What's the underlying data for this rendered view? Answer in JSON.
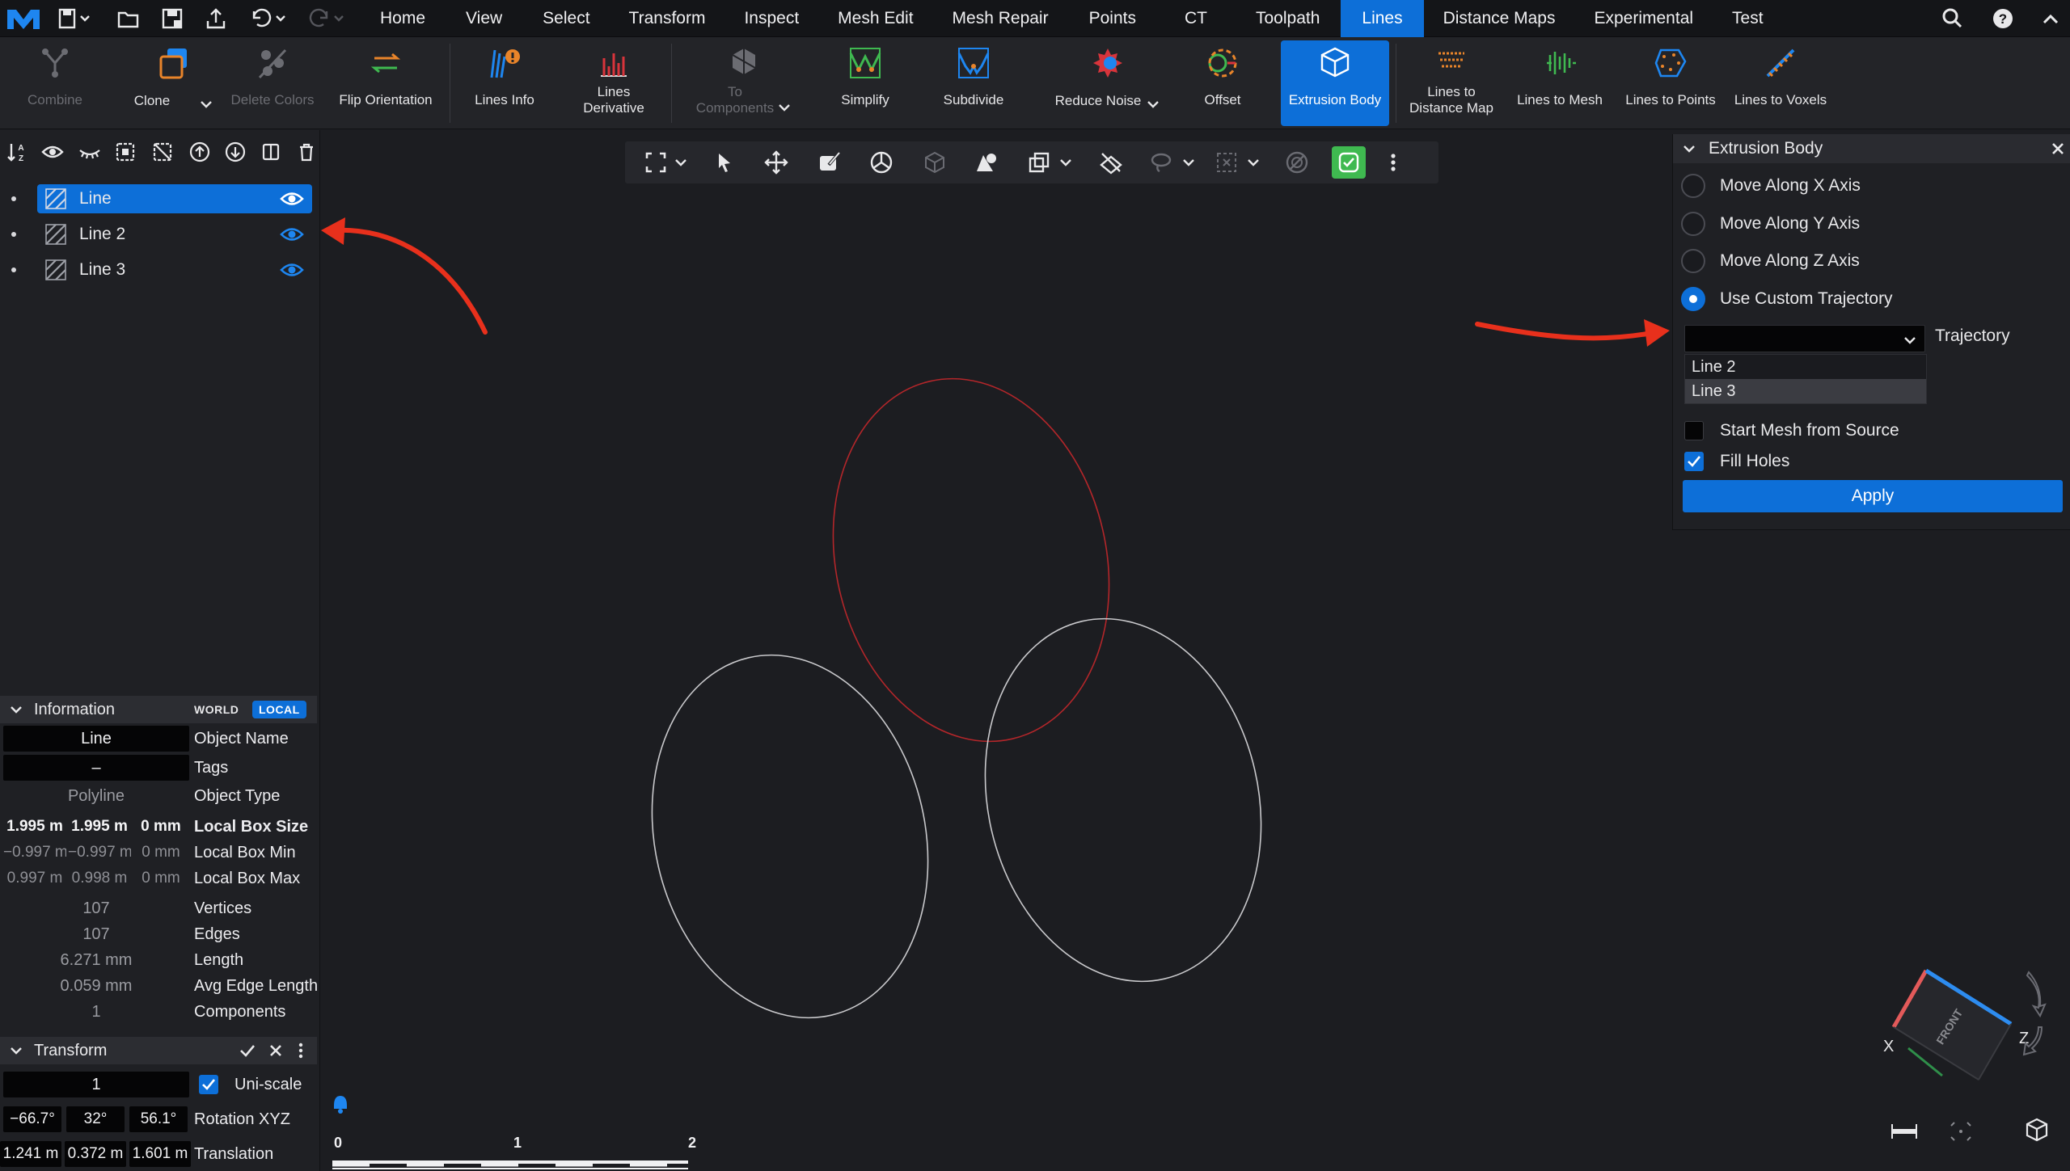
{
  "menu": {
    "tabs": [
      "Home",
      "View",
      "Select",
      "Transform",
      "Inspect",
      "Mesh Edit",
      "Mesh Repair",
      "Points",
      "CT",
      "Toolpath",
      "Lines",
      "Distance Maps",
      "Experimental",
      "Test"
    ],
    "active_tab": "Lines"
  },
  "ribbon": {
    "combine": "Combine",
    "clone": "Clone",
    "delete_colors": "Delete Colors",
    "flip_orientation": "Flip Orientation",
    "lines_info": "Lines Info",
    "lines_derivative": "Lines\nDerivative",
    "to_components": "To\nComponents",
    "simplify": "Simplify",
    "subdivide": "Subdivide",
    "reduce_noise": "Reduce Noise",
    "offset": "Offset",
    "extrusion_body": "Extrusion Body",
    "lines_to_distance_map": "Lines to\nDistance Map",
    "lines_to_mesh": "Lines to Mesh",
    "lines_to_points": "Lines to Points",
    "lines_to_voxels": "Lines to Voxels"
  },
  "scene_tree": {
    "items": [
      {
        "label": "Line",
        "selected": true
      },
      {
        "label": "Line 2",
        "selected": false
      },
      {
        "label": "Line 3",
        "selected": false
      }
    ]
  },
  "information": {
    "title": "Information",
    "world": "WORLD",
    "local": "LOCAL",
    "object_name_value": "Line",
    "object_name_label": "Object Name",
    "tags_value": "–",
    "tags_label": "Tags",
    "object_type_value": "Polyline",
    "object_type_label": "Object Type",
    "box_size": [
      "1.995 m",
      "1.995 m",
      "0 mm"
    ],
    "box_size_label": "Local Box Size",
    "box_min": [
      "−0.997 m",
      "−0.997 m",
      "0 mm"
    ],
    "box_min_label": "Local Box Min",
    "box_max": [
      "0.997 m",
      "0.998 m",
      "0 mm"
    ],
    "box_max_label": "Local Box Max",
    "vertices_value": "107",
    "vertices_label": "Vertices",
    "edges_value": "107",
    "edges_label": "Edges",
    "length_value": "6.271 mm",
    "length_label": "Length",
    "avg_edge_value": "0.059 mm",
    "avg_edge_label": "Avg Edge Length",
    "components_value": "1",
    "components_label": "Components"
  },
  "transform": {
    "title": "Transform",
    "scale_value": "1",
    "uniscale_label": "Uni-scale",
    "rotation": [
      "−66.7°",
      "32°",
      "56.1°"
    ],
    "rotation_label": "Rotation XYZ",
    "translation": [
      "1.241 m",
      "0.372 m",
      "1.601 m"
    ],
    "translation_label": "Translation"
  },
  "extrusion_panel": {
    "title": "Extrusion Body",
    "options": [
      "Move Along X Axis",
      "Move Along Y Axis",
      "Move Along Z Axis",
      "Use Custom Trajectory"
    ],
    "selected_option": "Use Custom Trajectory",
    "trajectory_label": "Trajectory",
    "trajectory_value": "",
    "dropdown_options": [
      "Line 2",
      "Line 3"
    ],
    "highlighted_option": "Line 3",
    "start_mesh_label": "Start Mesh from Source",
    "start_mesh_checked": false,
    "fill_holes_label": "Fill Holes",
    "fill_holes_checked": true,
    "apply_label": "Apply"
  },
  "scale_bar": [
    "0",
    "1",
    "2"
  ],
  "view_cube": {
    "face": "FRONT",
    "x_label": "X",
    "z_label": "Z"
  },
  "colors": {
    "accent": "#0d6fd8",
    "selected_curve": "#b3262a",
    "curve": "#c9c9cc",
    "annotation_arrow": "#e8301c"
  }
}
